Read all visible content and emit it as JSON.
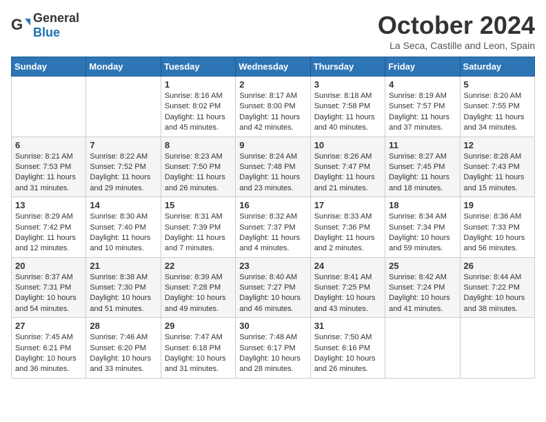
{
  "logo": {
    "general": "General",
    "blue": "Blue"
  },
  "title": "October 2024",
  "subtitle": "La Seca, Castille and Leon, Spain",
  "headers": [
    "Sunday",
    "Monday",
    "Tuesday",
    "Wednesday",
    "Thursday",
    "Friday",
    "Saturday"
  ],
  "weeks": [
    [
      null,
      null,
      {
        "day": 1,
        "sunrise": "8:16 AM",
        "sunset": "8:02 PM",
        "daylight": "11 hours and 45 minutes."
      },
      {
        "day": 2,
        "sunrise": "8:17 AM",
        "sunset": "8:00 PM",
        "daylight": "11 hours and 42 minutes."
      },
      {
        "day": 3,
        "sunrise": "8:18 AM",
        "sunset": "7:58 PM",
        "daylight": "11 hours and 40 minutes."
      },
      {
        "day": 4,
        "sunrise": "8:19 AM",
        "sunset": "7:57 PM",
        "daylight": "11 hours and 37 minutes."
      },
      {
        "day": 5,
        "sunrise": "8:20 AM",
        "sunset": "7:55 PM",
        "daylight": "11 hours and 34 minutes."
      }
    ],
    [
      {
        "day": 6,
        "sunrise": "8:21 AM",
        "sunset": "7:53 PM",
        "daylight": "11 hours and 31 minutes."
      },
      {
        "day": 7,
        "sunrise": "8:22 AM",
        "sunset": "7:52 PM",
        "daylight": "11 hours and 29 minutes."
      },
      {
        "day": 8,
        "sunrise": "8:23 AM",
        "sunset": "7:50 PM",
        "daylight": "11 hours and 26 minutes."
      },
      {
        "day": 9,
        "sunrise": "8:24 AM",
        "sunset": "7:48 PM",
        "daylight": "11 hours and 23 minutes."
      },
      {
        "day": 10,
        "sunrise": "8:26 AM",
        "sunset": "7:47 PM",
        "daylight": "11 hours and 21 minutes."
      },
      {
        "day": 11,
        "sunrise": "8:27 AM",
        "sunset": "7:45 PM",
        "daylight": "11 hours and 18 minutes."
      },
      {
        "day": 12,
        "sunrise": "8:28 AM",
        "sunset": "7:43 PM",
        "daylight": "11 hours and 15 minutes."
      }
    ],
    [
      {
        "day": 13,
        "sunrise": "8:29 AM",
        "sunset": "7:42 PM",
        "daylight": "11 hours and 12 minutes."
      },
      {
        "day": 14,
        "sunrise": "8:30 AM",
        "sunset": "7:40 PM",
        "daylight": "11 hours and 10 minutes."
      },
      {
        "day": 15,
        "sunrise": "8:31 AM",
        "sunset": "7:39 PM",
        "daylight": "11 hours and 7 minutes."
      },
      {
        "day": 16,
        "sunrise": "8:32 AM",
        "sunset": "7:37 PM",
        "daylight": "11 hours and 4 minutes."
      },
      {
        "day": 17,
        "sunrise": "8:33 AM",
        "sunset": "7:36 PM",
        "daylight": "11 hours and 2 minutes."
      },
      {
        "day": 18,
        "sunrise": "8:34 AM",
        "sunset": "7:34 PM",
        "daylight": "10 hours and 59 minutes."
      },
      {
        "day": 19,
        "sunrise": "8:36 AM",
        "sunset": "7:33 PM",
        "daylight": "10 hours and 56 minutes."
      }
    ],
    [
      {
        "day": 20,
        "sunrise": "8:37 AM",
        "sunset": "7:31 PM",
        "daylight": "10 hours and 54 minutes."
      },
      {
        "day": 21,
        "sunrise": "8:38 AM",
        "sunset": "7:30 PM",
        "daylight": "10 hours and 51 minutes."
      },
      {
        "day": 22,
        "sunrise": "8:39 AM",
        "sunset": "7:28 PM",
        "daylight": "10 hours and 49 minutes."
      },
      {
        "day": 23,
        "sunrise": "8:40 AM",
        "sunset": "7:27 PM",
        "daylight": "10 hours and 46 minutes."
      },
      {
        "day": 24,
        "sunrise": "8:41 AM",
        "sunset": "7:25 PM",
        "daylight": "10 hours and 43 minutes."
      },
      {
        "day": 25,
        "sunrise": "8:42 AM",
        "sunset": "7:24 PM",
        "daylight": "10 hours and 41 minutes."
      },
      {
        "day": 26,
        "sunrise": "8:44 AM",
        "sunset": "7:22 PM",
        "daylight": "10 hours and 38 minutes."
      }
    ],
    [
      {
        "day": 27,
        "sunrise": "7:45 AM",
        "sunset": "6:21 PM",
        "daylight": "10 hours and 36 minutes."
      },
      {
        "day": 28,
        "sunrise": "7:46 AM",
        "sunset": "6:20 PM",
        "daylight": "10 hours and 33 minutes."
      },
      {
        "day": 29,
        "sunrise": "7:47 AM",
        "sunset": "6:18 PM",
        "daylight": "10 hours and 31 minutes."
      },
      {
        "day": 30,
        "sunrise": "7:48 AM",
        "sunset": "6:17 PM",
        "daylight": "10 hours and 28 minutes."
      },
      {
        "day": 31,
        "sunrise": "7:50 AM",
        "sunset": "6:16 PM",
        "daylight": "10 hours and 26 minutes."
      },
      null,
      null
    ]
  ],
  "labels": {
    "sunrise": "Sunrise:",
    "sunset": "Sunset:",
    "daylight": "Daylight:"
  }
}
